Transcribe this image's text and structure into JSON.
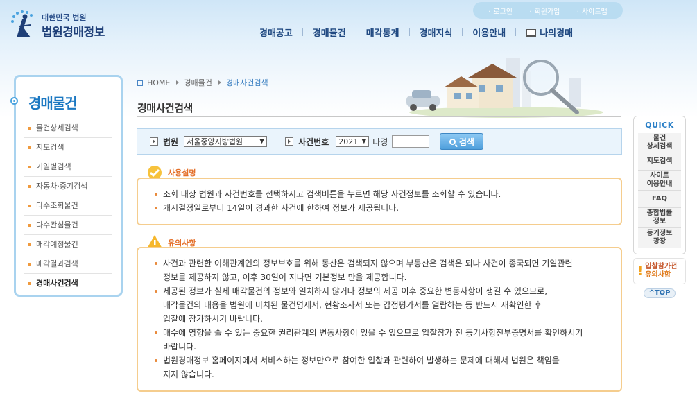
{
  "brand": {
    "small": "대한민국 법원",
    "big": "법원경매정보"
  },
  "util_links": [
    "로그인",
    "회원가입",
    "사이트맵"
  ],
  "gnb": [
    "경매공고",
    "경매물건",
    "매각통계",
    "경매지식",
    "이용안내",
    "나의경매"
  ],
  "left_menu": {
    "title": "경매물건",
    "items": [
      "물건상세검색",
      "지도검색",
      "기일별검색",
      "자동차·중기검색",
      "다수조회물건",
      "다수관심물건",
      "매각예정물건",
      "매각결과검색",
      "경매사건검색"
    ],
    "active_index": 8
  },
  "breadcrumb": [
    "HOME",
    "경매물건",
    "경매사건검색"
  ],
  "page_title": "경매사건검색",
  "search": {
    "court_label": "법원",
    "court_value": "서울중앙지방법원",
    "case_label": "사건번호",
    "year_value": "2021",
    "type_label": "타경",
    "case_number_value": "",
    "button_label": "검색"
  },
  "usage": {
    "title": "사용설명",
    "items": [
      "조회 대상 법원과 사건번호를 선택하시고 검색버튼을 누르면 해당 사건정보를 조회할 수 있습니다.",
      "개시결정일로부터 14일이 경과한 사건에 한하여 정보가 제공됩니다."
    ]
  },
  "caution": {
    "title": "유의사항",
    "items": [
      [
        "사건과 관련한 이해관계인의 정보보호를 위해 동산은 검색되지 않으며 부동산은 검색은 되나 사건이 종국되면 기일관련",
        "정보를 제공하지 않고, 이후 30일이 지나면 기본정보 만을 제공합니다."
      ],
      [
        "제공된 정보가 실제 매각물건의 정보와 일치하지 않거나 정보의 제공 이후 중요한 변동사항이 생길 수 있으므로,",
        "매각물건의 내용을 법원에 비치된 물건명세서, 현황조사서 또는 감정평가서를 열람하는 등 반드시 재확인한 후",
        "입찰에 참가하시기 바랍니다."
      ],
      [
        "매수에 영향을 줄 수 있는 중요한 권리관계의 변동사항이 있을 수 있으므로 입찰참가 전 등기사항전부증명서를 확인하시기",
        "바랍니다."
      ],
      [
        "법원경매정보 홈페이지에서 서비스하는 정보만으로 참여한 입찰과 관련하여 발생하는 문제에 대해서 법원은 책임을",
        "지지 않습니다."
      ]
    ]
  },
  "quick": {
    "title": "QUICK",
    "items": [
      [
        "물건",
        "상세검색"
      ],
      [
        "지도검색"
      ],
      [
        "사이트",
        "이용안내"
      ],
      [
        "FAQ"
      ],
      [
        "종합법률",
        "정보"
      ],
      [
        "등기정보",
        "광장"
      ]
    ]
  },
  "notice": {
    "line1": "입찰참가전",
    "line2": "유의사항"
  },
  "top_label": "TOP",
  "colors": {
    "accent": "#1b78c2",
    "orange": "#e4702a",
    "box_border": "#f5cd8e"
  }
}
